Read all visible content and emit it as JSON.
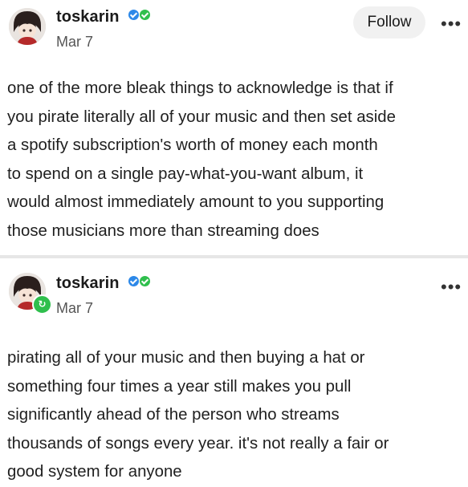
{
  "posts": [
    {
      "username": "toskarin",
      "date": "Mar 7",
      "follow_label": "Follow",
      "more_label": "•••",
      "body_lines": [
        "one of the more bleak things to acknowledge is that if",
        "you pirate literally all of your music and then set aside",
        "a spotify subscription's worth of money each month",
        "to spend on a single pay-what-you-want album, it",
        "would almost immediately amount to you supporting",
        "those musicians more than streaming does"
      ]
    },
    {
      "username": "toskarin",
      "date": "Mar 7",
      "more_label": "•••",
      "reblog_icon": "↻",
      "body_lines": [
        "pirating all of your music and then buying a hat or",
        "something four times a year still makes you pull",
        "significantly ahead of the person who streams",
        "thousands of songs every year. it's not really a fair or",
        "good system for anyone"
      ]
    }
  ],
  "colors": {
    "verified_blue": "#2c88e8",
    "verified_green": "#2fbf4d",
    "follow_bg": "#f1f1f1",
    "divider": "#e6e6e6"
  }
}
